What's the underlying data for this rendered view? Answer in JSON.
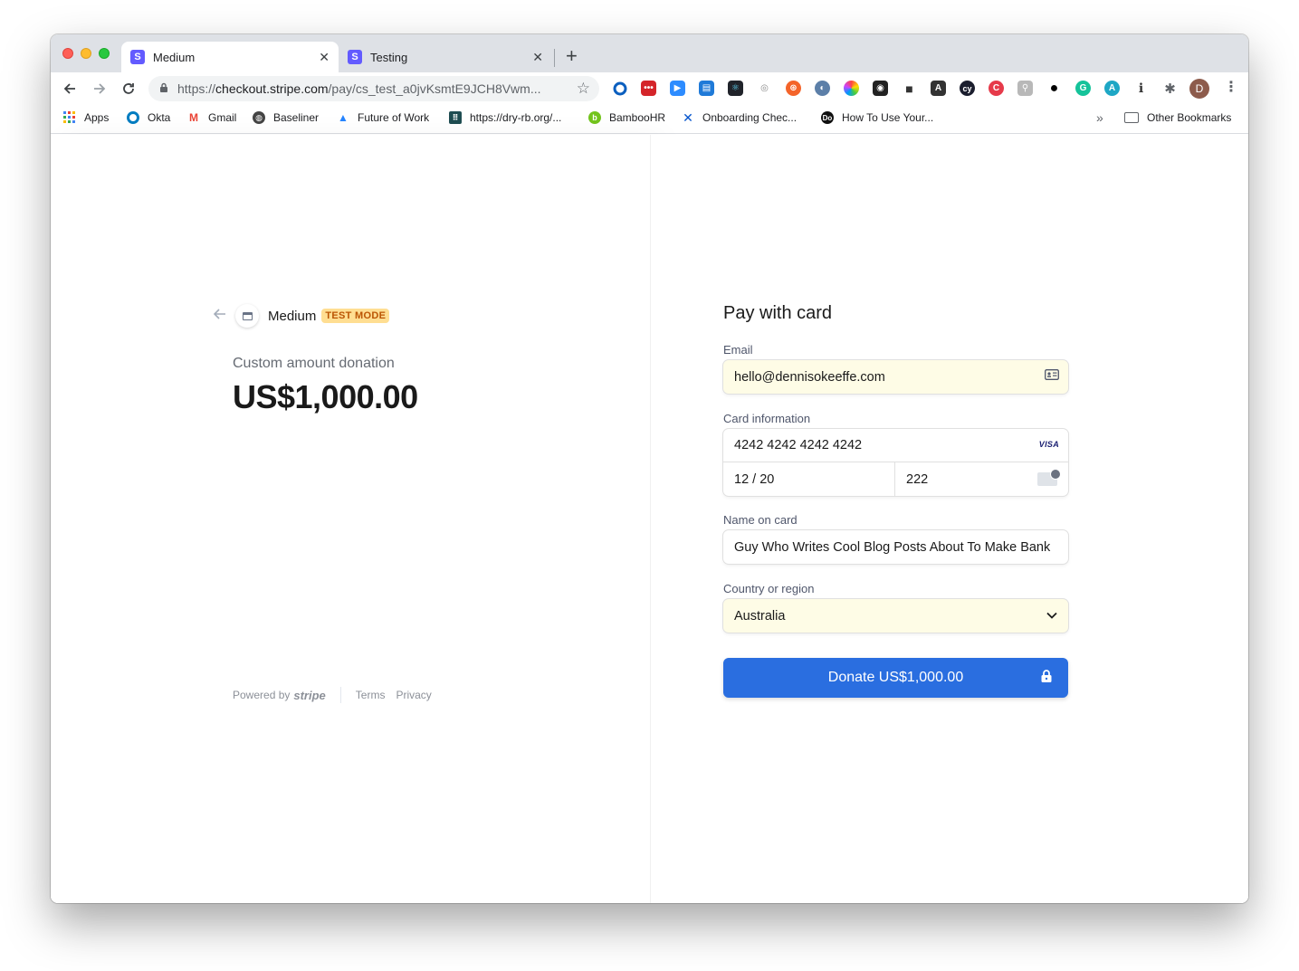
{
  "browser": {
    "tabs": [
      {
        "title": "Medium",
        "favicon": "S"
      },
      {
        "title": "Testing",
        "favicon": "S"
      }
    ],
    "url_prefix": "https://",
    "url_host": "checkout.stripe.com",
    "url_path": "/pay/cs_test_a0jvKsmtE9JCH8Vwm...",
    "profile_initial": "D",
    "bookmarks": [
      {
        "label": "Apps"
      },
      {
        "label": "Okta"
      },
      {
        "label": "Gmail"
      },
      {
        "label": "Baseliner"
      },
      {
        "label": "Future of Work"
      },
      {
        "label": "https://dry-rb.org/..."
      },
      {
        "label": "BambooHR"
      },
      {
        "label": "Onboarding Chec..."
      },
      {
        "label": "How To Use Your..."
      }
    ],
    "other_bookmarks": "Other Bookmarks",
    "more_bookmarks": "»"
  },
  "checkout": {
    "merchant": "Medium",
    "badge": "TEST MODE",
    "product": "Custom amount donation",
    "amount": "US$1,000.00",
    "footer": {
      "powered_by": "Powered by",
      "brand": "stripe",
      "terms": "Terms",
      "privacy": "Privacy"
    },
    "form": {
      "title": "Pay with card",
      "email_label": "Email",
      "email_value": "hello@dennisokeeffe.com",
      "card_label": "Card information",
      "card_number": "4242 4242 4242 4242",
      "card_brand": "VISA",
      "expiry": "12 / 20",
      "cvc": "222",
      "name_label": "Name on card",
      "name_value": "Guy Who Writes Cool Blog Posts About To Make Bank",
      "country_label": "Country or region",
      "country_value": "Australia",
      "button_label": "Donate US$1,000.00"
    }
  },
  "colors": {
    "accent": "#2a6ee0",
    "badge_bg": "#ffde92",
    "badge_text": "#bb5504",
    "autofill_bg": "#fefce6",
    "stripe_purple": "#635bff"
  }
}
